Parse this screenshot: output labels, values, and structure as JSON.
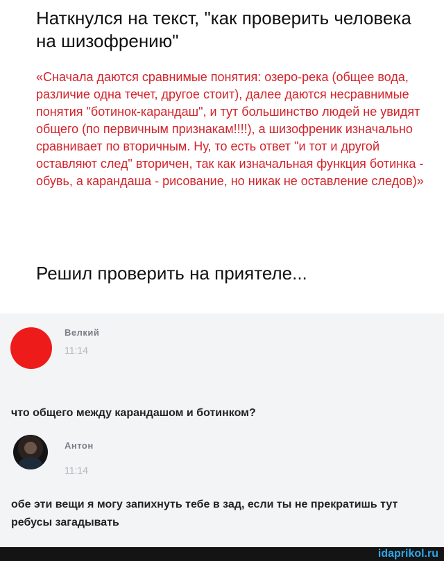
{
  "header": {
    "title": "Наткнулся на  текст, \"как проверить человека на шизофрению\"",
    "quote": "«Сначала даются сравнимые понятия: озеро-река (общее вода, различие одна течет, другое стоит), далее даются несравнимые понятия \"ботинок-карандаш\", и тут большинство людей не увидят общего (по первичным признакам!!!!), а шизофреник изначально сравнивает по вторичным. Ну, то есть ответ \"и тот и другой оставляют след\" вторичен, так как изначальная функция ботинка - обувь, а карандаша - рисование, но никак не оставление следов)»",
    "subtitle": "Решил проверить на приятеле..."
  },
  "chat": {
    "messages": [
      {
        "author": "Велкий",
        "time": "11:14",
        "text": "что общего между карандашом и ботинком?",
        "avatar_color": "#ee1b1b"
      },
      {
        "author": "Антон",
        "time": "11:14",
        "text": "обе эти вещи я могу запихнуть тебе в зад, если ты не прекратишь тут ребусы загадывать"
      }
    ]
  },
  "footer": {
    "watermark": "idaprikol.ru",
    "watermark_color": "#2ea6ea"
  }
}
